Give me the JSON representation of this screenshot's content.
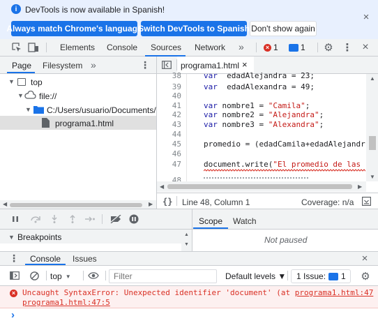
{
  "infobar": {
    "message": "DevTools is now available in Spanish!",
    "btn_match": "Always match Chrome's language",
    "btn_switch": "Switch DevTools to Spanish",
    "btn_dismiss": "Don't show again"
  },
  "toolbar": {
    "tabs": [
      "Elements",
      "Console",
      "Sources",
      "Network"
    ],
    "active_tab": "Sources",
    "more": "»",
    "errors_count": "1",
    "issues_count": "1"
  },
  "navigator": {
    "tab_page": "Page",
    "tab_filesystem": "Filesystem",
    "more": "»",
    "tree": {
      "top": "top",
      "origin": "file://",
      "folder": "C:/Users/usuario/Documents/L",
      "file": "programa1.html"
    }
  },
  "editor": {
    "open_file": "programa1.html",
    "line_numbers": [
      "38",
      "39",
      "40",
      "41",
      "42",
      "43",
      "44",
      "45",
      "46",
      "47",
      "48"
    ],
    "code": {
      "l38_kw": "var",
      "l38_rest": "  edadAlejandra = 23;",
      "l39_kw": "var",
      "l39_rest": "  edadAlexandra = 49;",
      "l41_kw": "var",
      "l41_rest": " nombre1 = ",
      "l41_str": "\"Camila\"",
      "l41_end": ";",
      "l42_kw": "var",
      "l42_rest": " nombre2 = ",
      "l42_str": "\"Alejandra\"",
      "l42_end": ";",
      "l43_kw": "var",
      "l43_rest": " nombre3 = ",
      "l43_str": "\"Alexandra\"",
      "l43_end": ";",
      "l45": "promedio = (edadCamila+edadAlejandra+",
      "l47_pre": "document.write(",
      "l47_str": "\"El promedio de las ed"
    },
    "status_braces": "{}",
    "cursor_pos": "Line 48, Column 1",
    "coverage": "Coverage: n/a"
  },
  "debugger": {
    "breakpoints": "Breakpoints",
    "tab_scope": "Scope",
    "tab_watch": "Watch",
    "not_paused": "Not paused"
  },
  "drawer": {
    "tab_console": "Console",
    "tab_issues": "Issues",
    "context": "top",
    "filter_placeholder": "Filter",
    "levels": "Default levels ▼",
    "issue_label": "1 Issue:",
    "issue_count": "1",
    "error_message": "Uncaught SyntaxError: Unexpected identifier 'document' (at ",
    "error_link": "programa1.html:47",
    "error_location": "programa1.html:47:5",
    "prompt": "›"
  },
  "colors": {
    "accent": "#1a73e8",
    "error": "#d93025",
    "panel": "#f1f3f4",
    "selected": "#e0e0e0"
  }
}
